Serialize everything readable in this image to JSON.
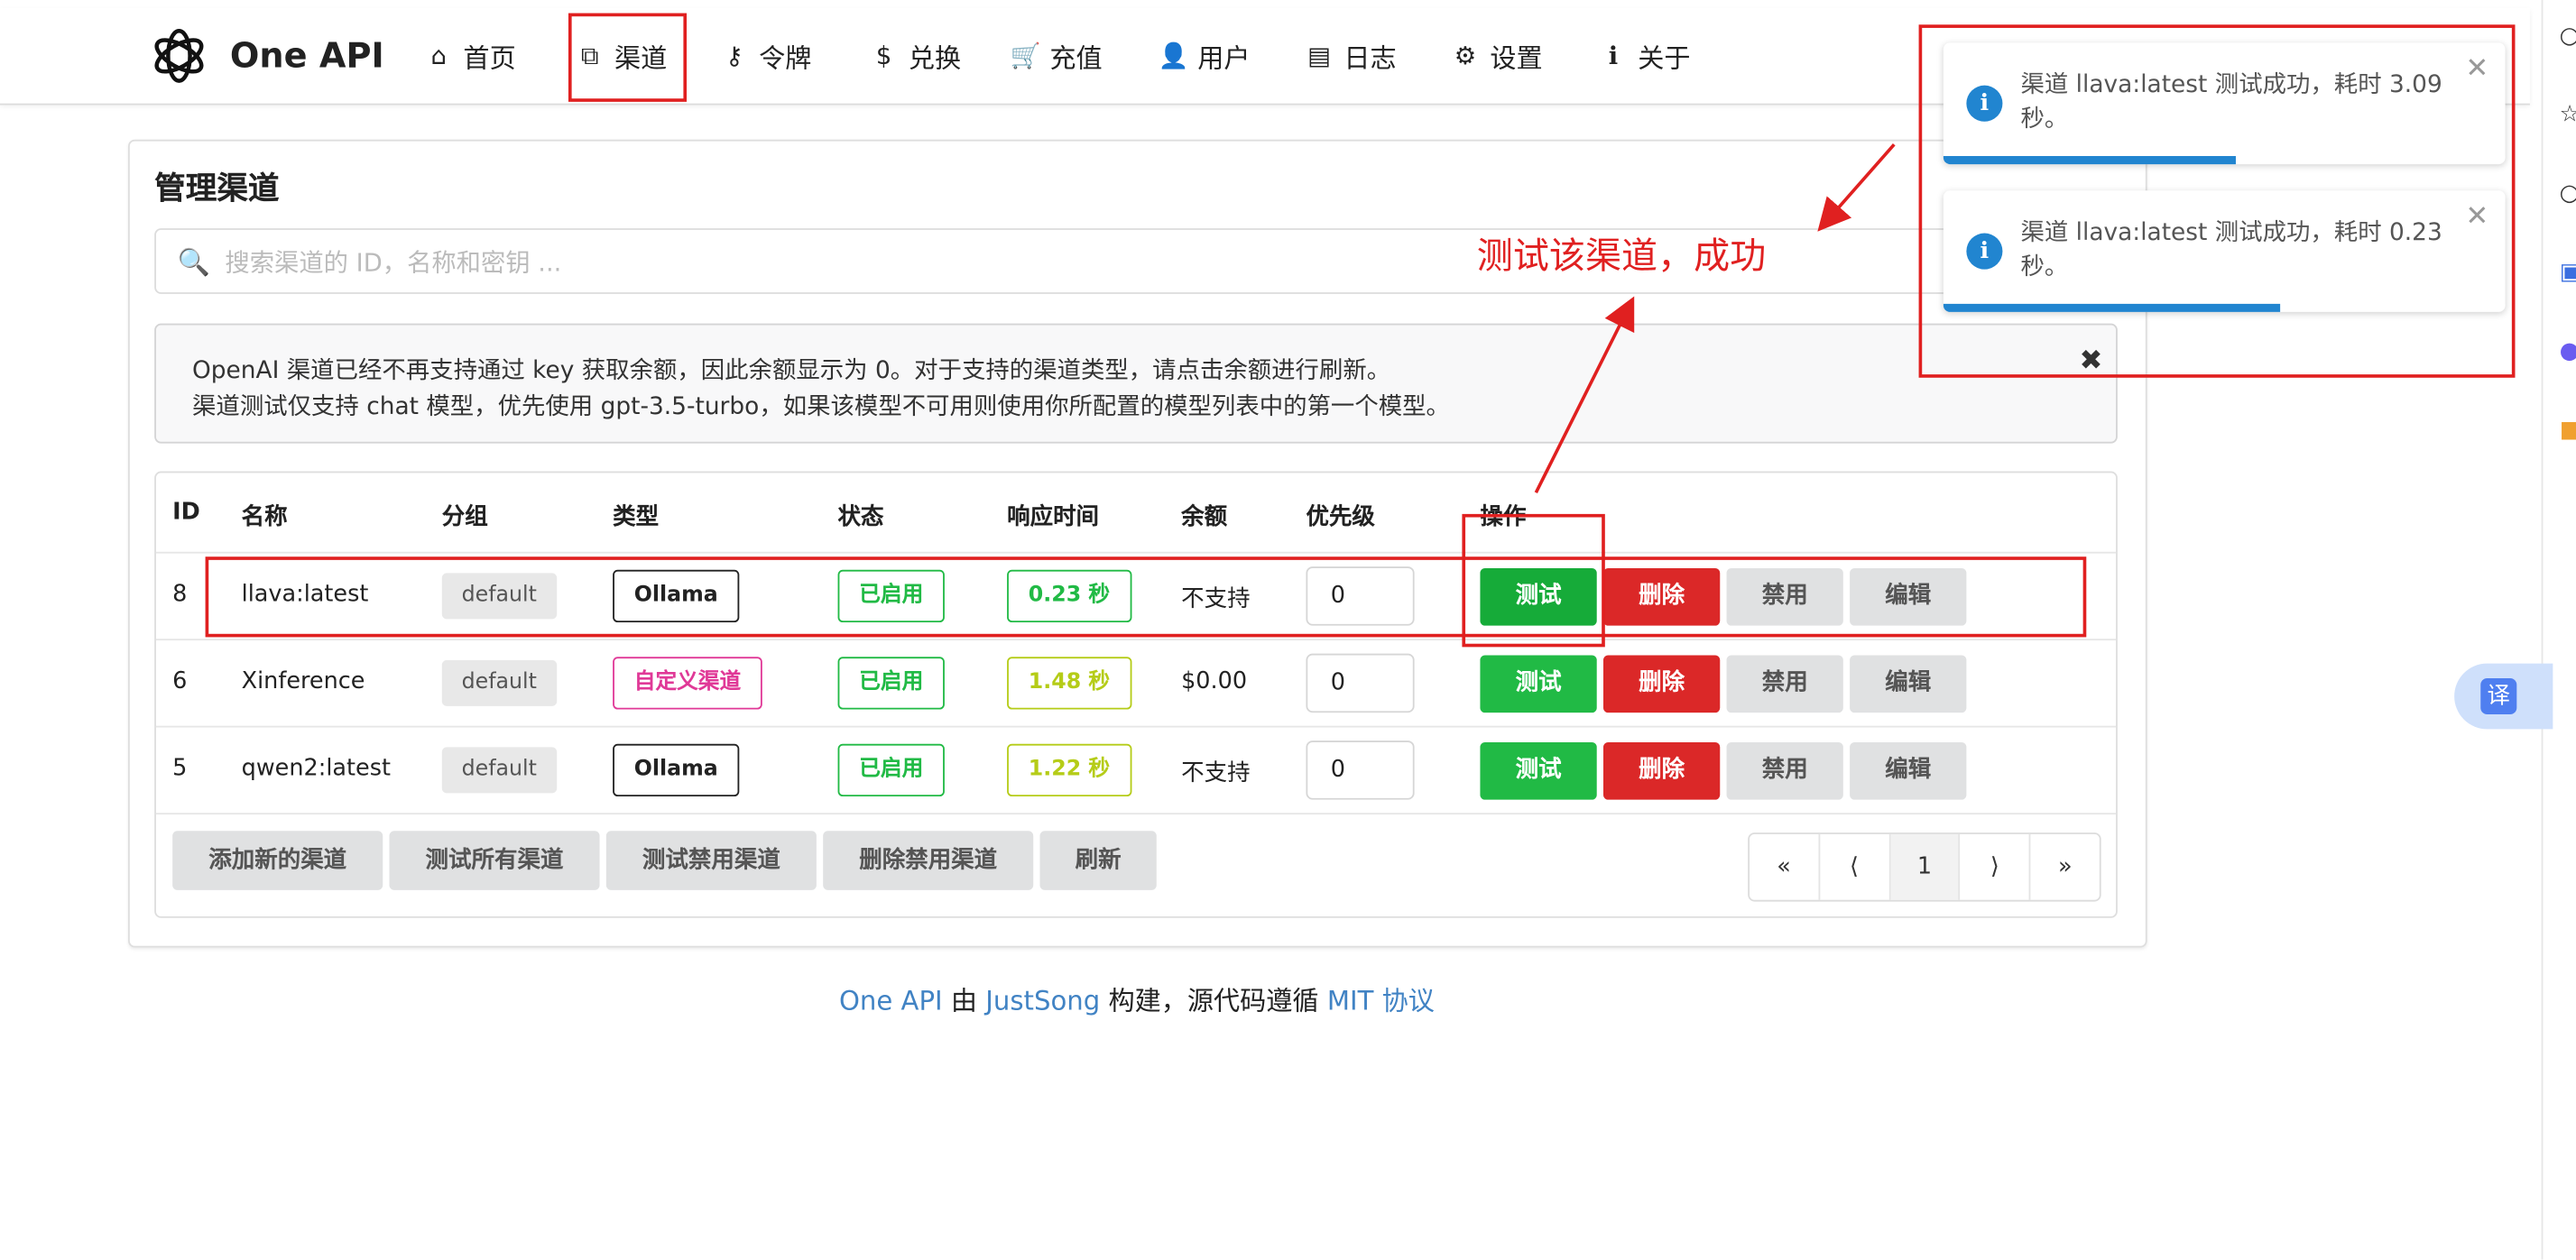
{
  "brand": {
    "name": "One API"
  },
  "nav": [
    {
      "label": "首页",
      "icon": "home-icon",
      "glyph": "⌂"
    },
    {
      "label": "渠道",
      "icon": "sitemap-icon",
      "glyph": "⧉"
    },
    {
      "label": "令牌",
      "icon": "key-icon",
      "glyph": "⚷"
    },
    {
      "label": "兑换",
      "icon": "dollar-icon",
      "glyph": "$"
    },
    {
      "label": "充值",
      "icon": "cart-icon",
      "glyph": "🛒"
    },
    {
      "label": "用户",
      "icon": "user-icon",
      "glyph": "👤"
    },
    {
      "label": "日志",
      "icon": "book-icon",
      "glyph": "▤"
    },
    {
      "label": "设置",
      "icon": "gear-icon",
      "glyph": "⚙"
    },
    {
      "label": "关于",
      "icon": "info-icon",
      "glyph": "ℹ"
    }
  ],
  "page": {
    "title": "管理渠道",
    "search_placeholder": "搜索渠道的 ID，名称和密钥 ..."
  },
  "notice": {
    "line1": "OpenAI 渠道已经不再支持通过 key 获取余额，因此余额显示为 0。对于支持的渠道类型，请点击余额进行刷新。",
    "line2": "渠道测试仅支持 chat 模型，优先使用 gpt-3.5-turbo，如果该模型不可用则使用你所配置的模型列表中的第一个模型。"
  },
  "table": {
    "headers": [
      "ID",
      "名称",
      "分组",
      "类型",
      "状态",
      "响应时间",
      "余额",
      "优先级",
      "操作"
    ],
    "rows": [
      {
        "id": "8",
        "name": "llava:latest",
        "group": "default",
        "type": "Ollama",
        "status": "已启用",
        "response": "0.23 秒",
        "balance": "不支持",
        "priority": "0"
      },
      {
        "id": "6",
        "name": "Xinference",
        "group": "default",
        "type": "自定义渠道",
        "status": "已启用",
        "response": "1.48 秒",
        "balance": "$0.00",
        "priority": "0"
      },
      {
        "id": "5",
        "name": "qwen2:latest",
        "group": "default",
        "type": "Ollama",
        "status": "已启用",
        "response": "1.22 秒",
        "balance": "不支持",
        "priority": "0"
      }
    ],
    "actions": {
      "test": "测试",
      "delete": "删除",
      "disable": "禁用",
      "edit": "编辑"
    },
    "footer_buttons": [
      "添加新的渠道",
      "测试所有渠道",
      "测试禁用渠道",
      "删除禁用渠道",
      "刷新"
    ],
    "pagination": [
      "«",
      "⟨",
      "1",
      "⟩",
      "»"
    ]
  },
  "footer": {
    "p1": "One API",
    "p2": " 由 ",
    "p3": "JustSong",
    "p4": " 构建，源代码遵循 ",
    "p5": "MIT 协议"
  },
  "annotation": {
    "text": "测试该渠道，成功"
  },
  "toasts": [
    {
      "message": "渠道 llava:latest 测试成功，耗时 3.09 秒。",
      "progress": 0.52
    },
    {
      "message": "渠道 llava:latest 测试成功，耗时 0.23 秒。",
      "progress": 0.6
    }
  ],
  "translate": {
    "label": "译"
  },
  "colors": {
    "red": "#e02020",
    "green": "#21ba45",
    "danger": "#db2828",
    "link": "#4183c4",
    "info": "#2185d0"
  }
}
